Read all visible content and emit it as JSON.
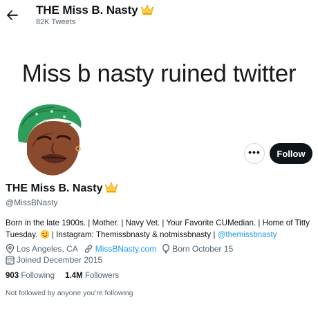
{
  "header": {
    "back_icon": "arrow-left-icon",
    "title": "THE Miss B. Nasty",
    "title_emoji": "crown-icon",
    "tweet_count": "82K Tweets"
  },
  "banner": {
    "text": "Miss b nasty ruined twitter"
  },
  "actions": {
    "more_label": "•••",
    "follow_label": "Follow"
  },
  "profile": {
    "display_name": "THE Miss B. Nasty",
    "handle": "@MissBNasty",
    "bio_part1": "Born in the late 1900s. | Mother. | Navy Vet. | Your Favorite CUMedian. | Home of Titty Tuesday.",
    "bio_emoji": "winking-tongue-face-icon",
    "bio_part2": "| Instagram: Themissbnasty & notmissbnasty |",
    "bio_link": "@themissbnasty",
    "location": "Los Angeles, CA",
    "website": "MissBNasty.com",
    "birthday": "Born October 15",
    "joined": "Joined December 2015"
  },
  "stats": {
    "following_count": "903",
    "following_label": "Following",
    "followers_count": "1.4M",
    "followers_label": "Followers"
  },
  "footer_note": "Not followed by anyone you’re following",
  "colors": {
    "link": "#1d9bf0",
    "text": "#0f1419",
    "muted": "#536471",
    "follow_bg": "#0f1419",
    "avatar_wrap": "#2e8b57"
  }
}
